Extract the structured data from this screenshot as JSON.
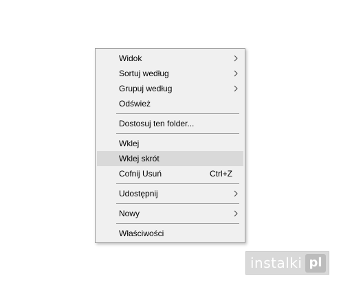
{
  "menu": {
    "items": [
      {
        "label": "Widok",
        "submenu": true
      },
      {
        "label": "Sortuj według",
        "submenu": true
      },
      {
        "label": "Grupuj według",
        "submenu": true
      },
      {
        "label": "Odśwież"
      },
      {
        "label": "Dostosuj ten folder..."
      },
      {
        "label": "Wklej"
      },
      {
        "label": "Wklej skrót",
        "highlighted": true
      },
      {
        "label": "Cofnij Usuń",
        "shortcut": "Ctrl+Z"
      },
      {
        "label": "Udostępnij",
        "submenu": true
      },
      {
        "label": "Nowy",
        "submenu": true
      },
      {
        "label": "Właściwości"
      }
    ],
    "chevron_icon": "chevron-right-icon",
    "colors": {
      "background": "#f0f0f0",
      "highlight": "#d9d9d9",
      "separator": "#a0a0a0"
    }
  },
  "watermark": {
    "text": "instalki",
    "badge": "pl"
  }
}
